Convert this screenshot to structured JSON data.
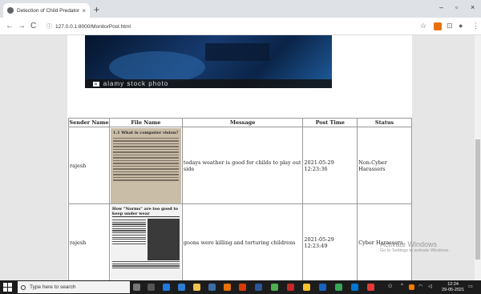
{
  "browser": {
    "tab_title": "Detection of Child Predators Cy",
    "tab_close": "×",
    "new_tab": "+",
    "address": "127.0.0.1:8000/MonitorPost.html",
    "back": "←",
    "forward": "→",
    "reload": "C",
    "minimize": "–",
    "maximize": "▫",
    "close": "×",
    "star": "☆",
    "menu": "⋮"
  },
  "banner": {
    "watermark": "alamy stock photo",
    "badge": "a"
  },
  "table": {
    "headers": [
      "Sender Name",
      "File Name",
      "Message",
      "Post Time",
      "Status"
    ],
    "rows": [
      {
        "sender": "rajesh",
        "file_heading": "1.1 What is computer vision?",
        "message": "todays weather is good for childs to play out side",
        "post_time": "2021-05-29 12:23:36",
        "status": "Non-Cyber Harassers"
      },
      {
        "sender": "rajesh",
        "file_heading": "How \"Norms\" are too good to keep under wear",
        "message": "goons were killing and torturing childrens",
        "post_time": "2021-05-29 12:23:49",
        "status": "Cyber Harassers"
      }
    ]
  },
  "watermark": {
    "line1": "Activate Windows",
    "line2": "Go to Settings to activate Windows."
  },
  "taskbar": {
    "search_placeholder": "Type here to search",
    "time": "12:24",
    "date": "29-05-2021"
  }
}
